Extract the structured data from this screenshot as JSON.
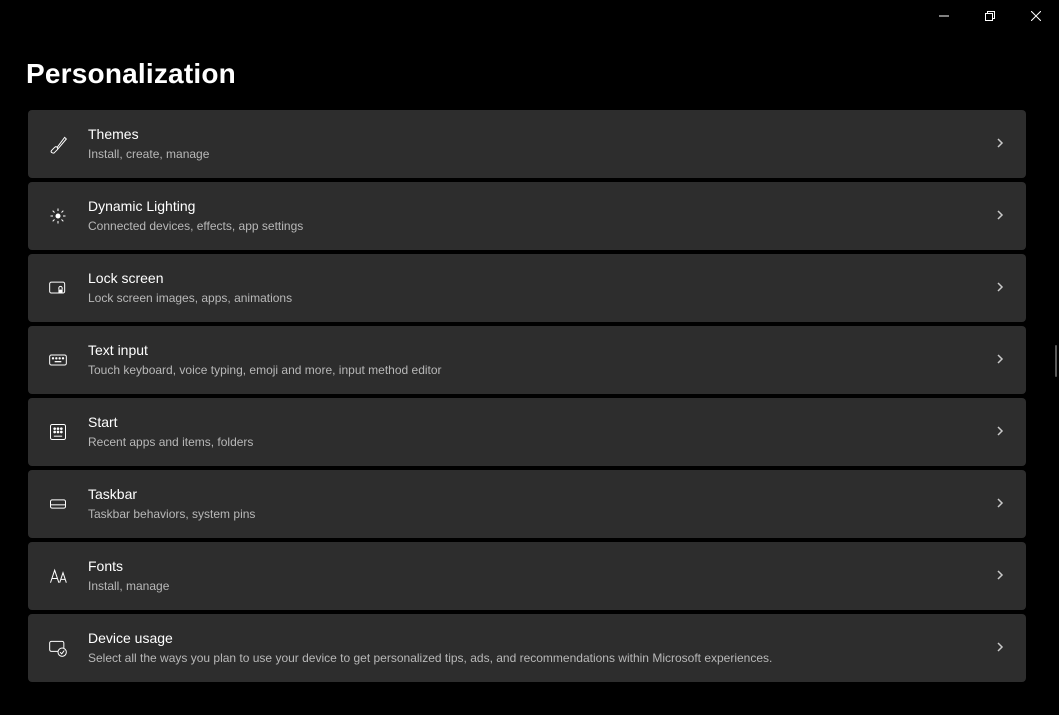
{
  "page": {
    "title": "Personalization"
  },
  "items": [
    {
      "id": "themes",
      "title": "Themes",
      "desc": "Install, create, manage"
    },
    {
      "id": "dynamic-lighting",
      "title": "Dynamic Lighting",
      "desc": "Connected devices, effects, app settings"
    },
    {
      "id": "lock-screen",
      "title": "Lock screen",
      "desc": "Lock screen images, apps, animations"
    },
    {
      "id": "text-input",
      "title": "Text input",
      "desc": "Touch keyboard, voice typing, emoji and more, input method editor"
    },
    {
      "id": "start",
      "title": "Start",
      "desc": "Recent apps and items, folders"
    },
    {
      "id": "taskbar",
      "title": "Taskbar",
      "desc": "Taskbar behaviors, system pins"
    },
    {
      "id": "fonts",
      "title": "Fonts",
      "desc": "Install, manage"
    },
    {
      "id": "device-usage",
      "title": "Device usage",
      "desc": "Select all the ways you plan to use your device to get personalized tips, ads, and recommendations within Microsoft experiences."
    }
  ]
}
